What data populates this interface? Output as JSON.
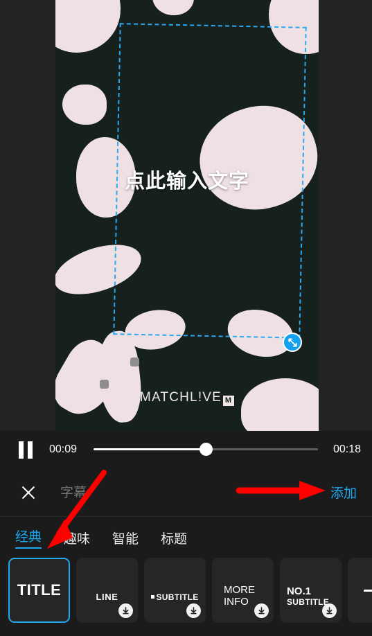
{
  "preview": {
    "canvas_text": "点此输入文字",
    "watermark": "MATCHL!VE",
    "watermark_logo": "M",
    "selection_handle_icon": "resize-diagonal-icon",
    "background_color": "#16201d",
    "blob_color": "#efe1e3",
    "selection_color": "#2aa8f2"
  },
  "player": {
    "play_state_icon": "pause-icon",
    "current_time": "00:09",
    "total_time": "00:18",
    "progress_percent": 50
  },
  "caption_bar": {
    "close_icon": "close-icon",
    "input_value": "",
    "input_placeholder": "字幕",
    "add_label": "添加",
    "add_color": "#1ba7f0"
  },
  "tabs": [
    {
      "label": "经典",
      "active": true
    },
    {
      "label": "趣味",
      "active": false
    },
    {
      "label": "智能",
      "active": false
    },
    {
      "label": "标题",
      "active": false
    }
  ],
  "templates": [
    {
      "id": "title",
      "label": "TITLE",
      "selected": true,
      "download": false
    },
    {
      "id": "line",
      "label": "LINE",
      "selected": false,
      "download": true
    },
    {
      "id": "subtitle",
      "label": "SUBTITLE",
      "selected": false,
      "download": true
    },
    {
      "id": "more-info",
      "label": "MORE\nINFO",
      "line1": "MORE",
      "line2": "INFO",
      "selected": false,
      "download": true
    },
    {
      "id": "no1",
      "label": "NO.1 SUBTITLE",
      "line1": "NO.1",
      "line2": "SUBTITLE",
      "selected": false,
      "download": true
    },
    {
      "id": "dash",
      "label": "",
      "selected": false,
      "download": false
    }
  ],
  "annotations": {
    "arrow_color": "#fe0000",
    "arrow_right_target": "添加",
    "arrow_diagonal_target": "经典"
  }
}
